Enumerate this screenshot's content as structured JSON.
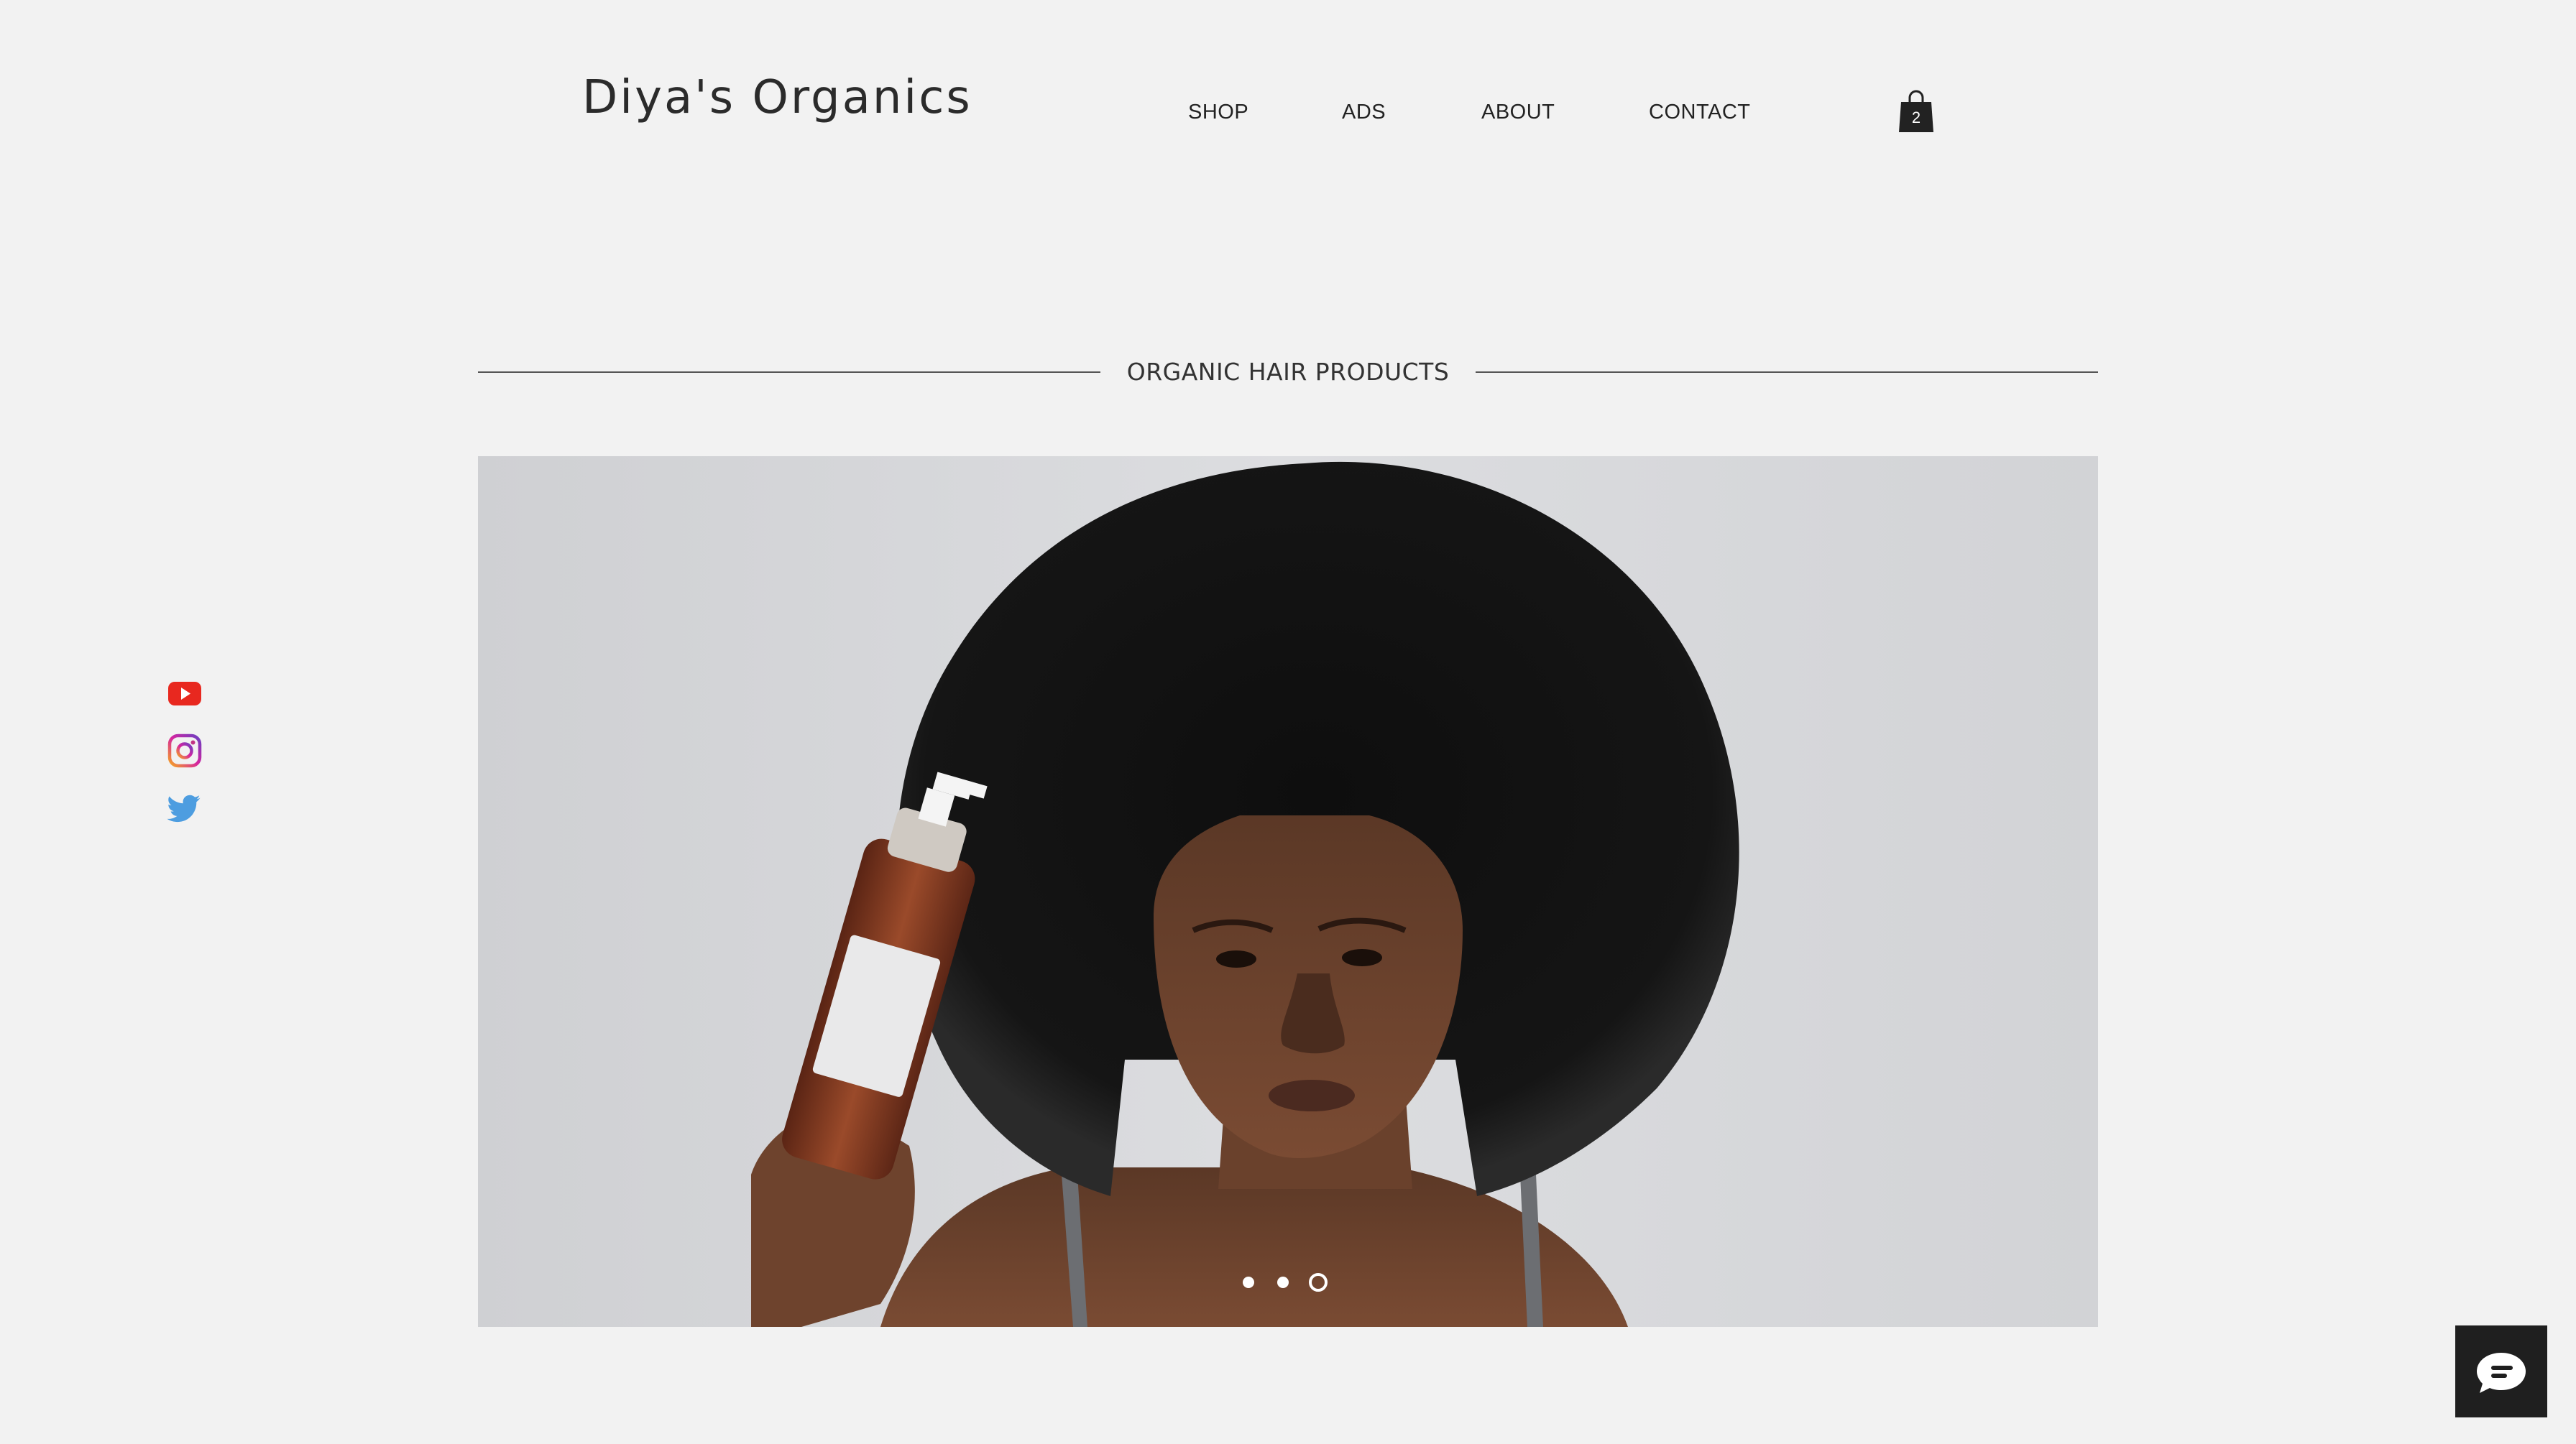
{
  "header": {
    "logo": "Diya's Organics",
    "nav": {
      "shop": "SHOP",
      "ads": "ADS",
      "about": "ABOUT",
      "contact": "CONTACT"
    },
    "cart": {
      "icon": "shopping-bag-icon",
      "count": "2"
    }
  },
  "section": {
    "title": "ORGANIC HAIR PRODUCTS"
  },
  "social": {
    "items": [
      {
        "icon": "youtube-icon",
        "color": "#e8281f"
      },
      {
        "icon": "instagram-icon",
        "color": "#c13584"
      },
      {
        "icon": "twitter-icon",
        "color": "#4d9de0"
      }
    ]
  },
  "slideshow": {
    "slide_count": 3,
    "active_slide": 3
  },
  "chat": {
    "icon": "chat-bubble-icon"
  },
  "colors": {
    "background": "#f2f2f2",
    "text": "#222222",
    "chat_button": "#1f1f1f"
  }
}
